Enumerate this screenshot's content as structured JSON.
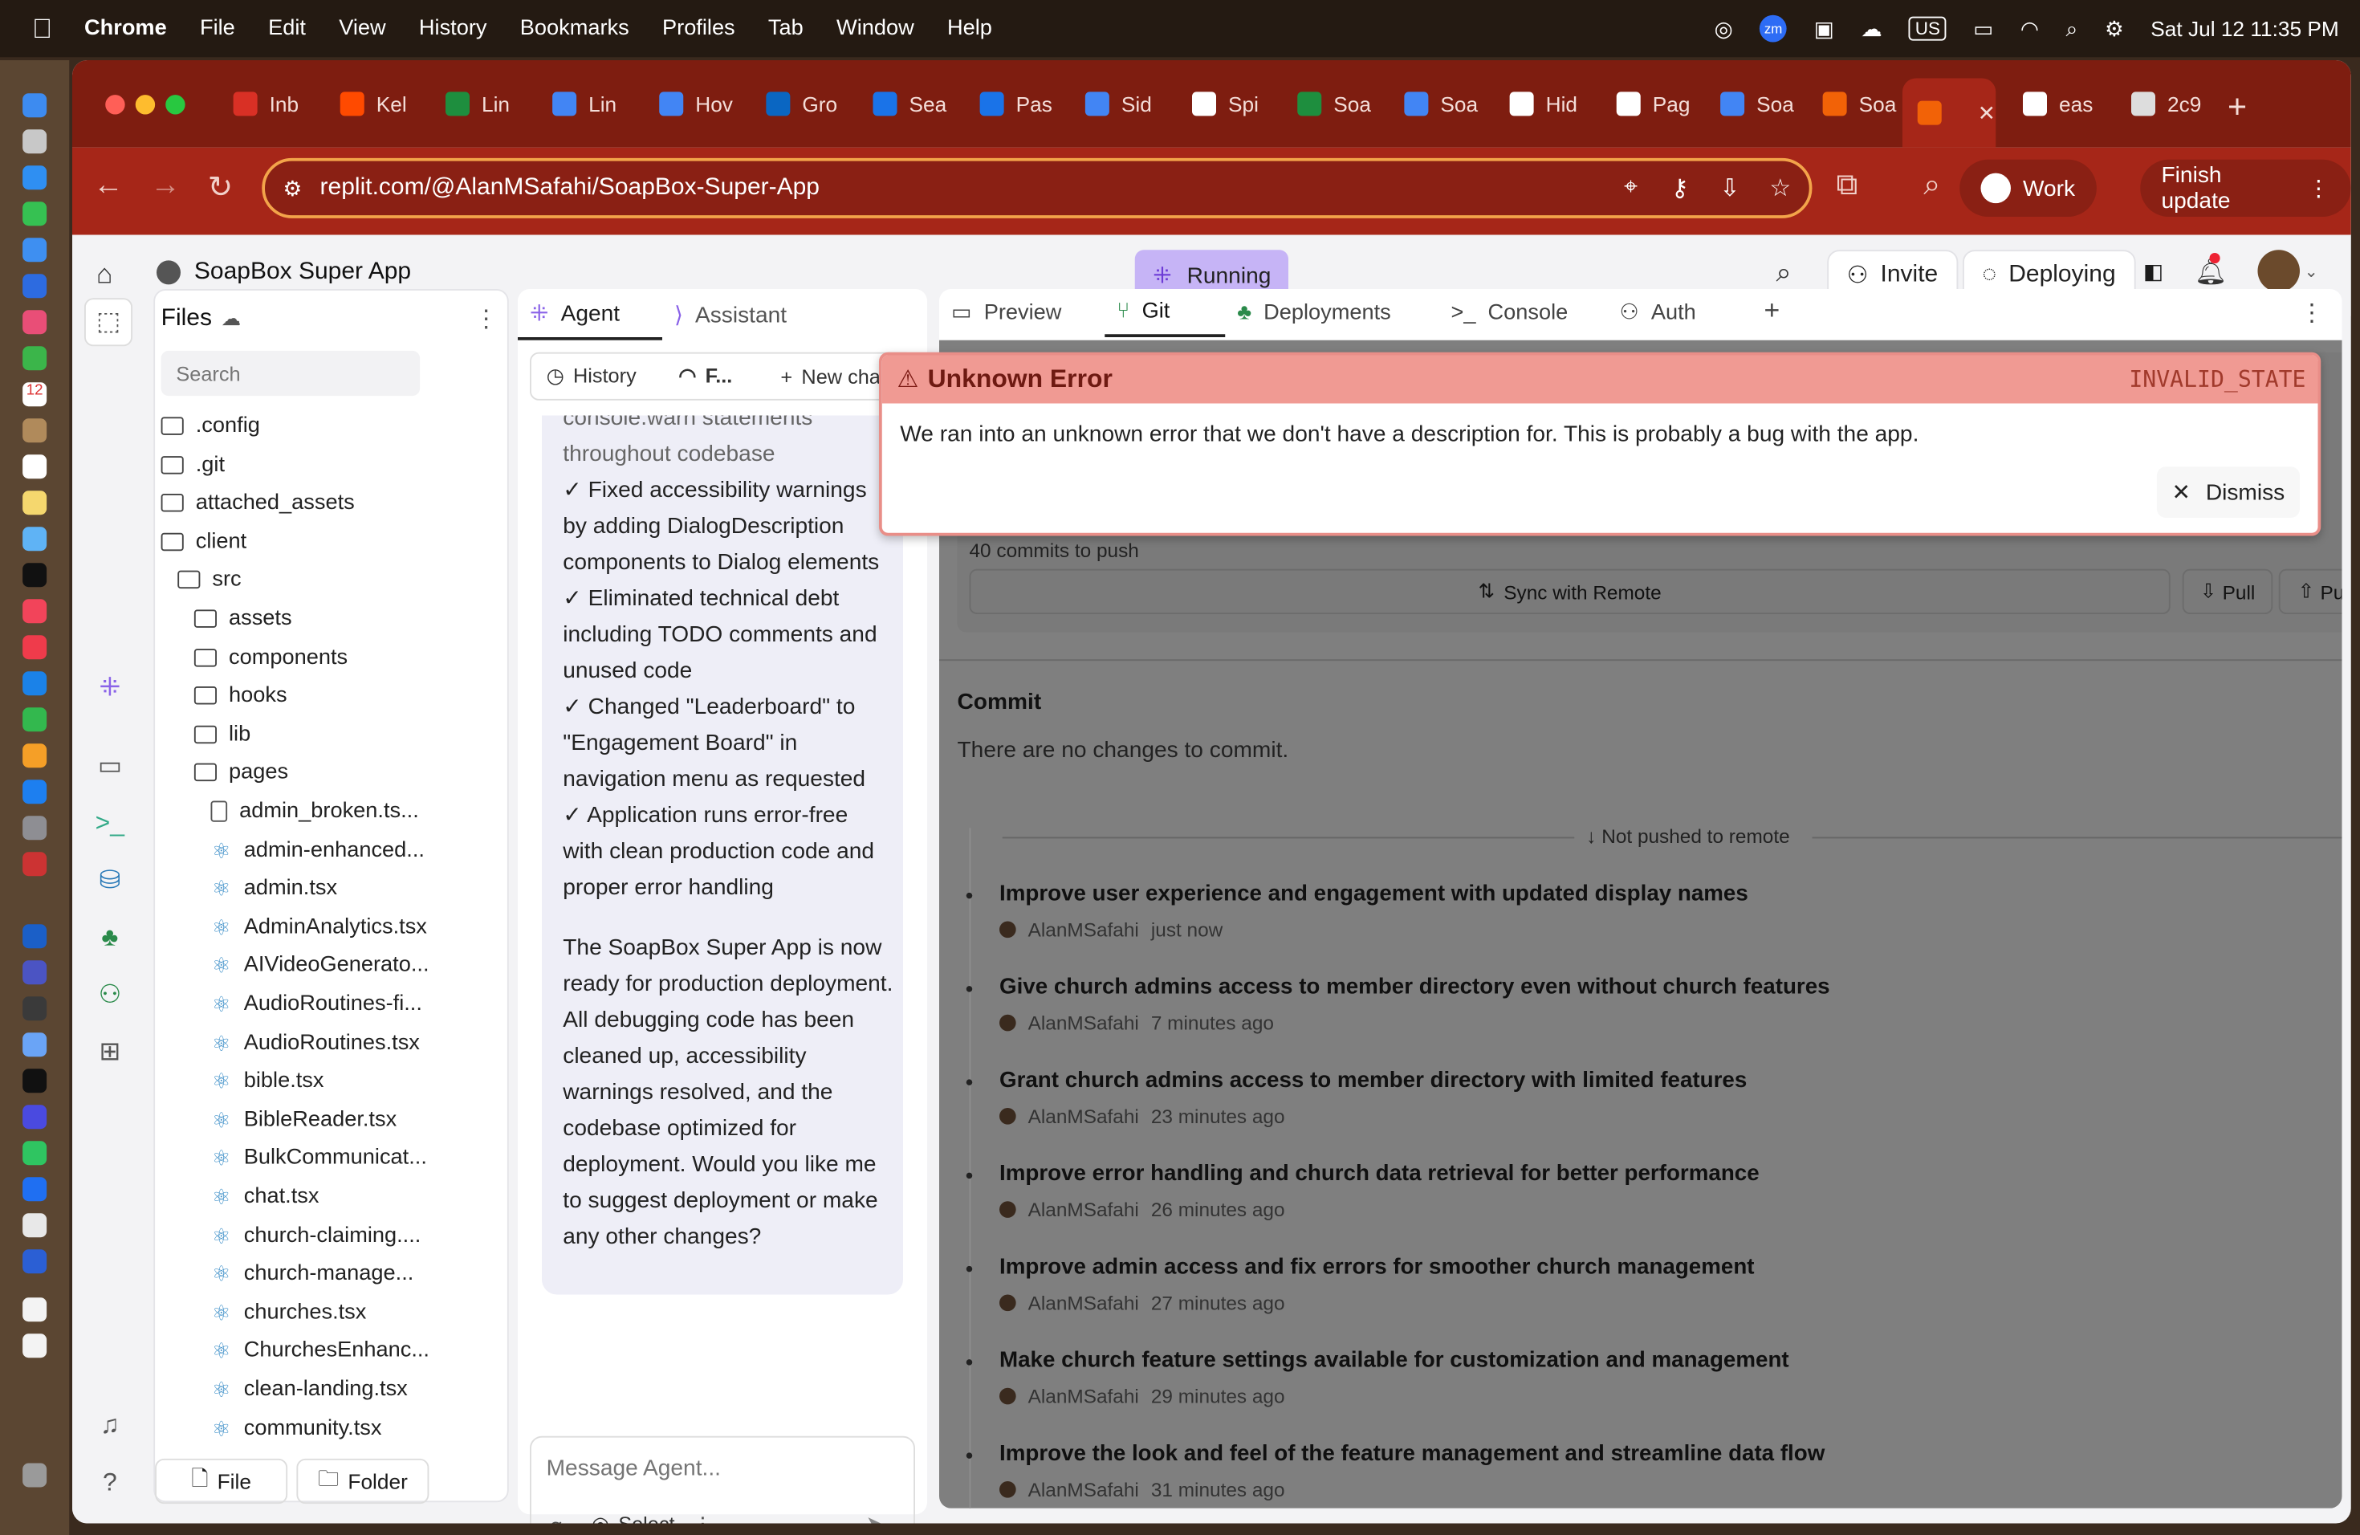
{
  "menubar": {
    "app": "Chrome",
    "items": [
      "File",
      "Edit",
      "View",
      "History",
      "Bookmarks",
      "Profiles",
      "Tab",
      "Window",
      "Help"
    ],
    "input_source": "US",
    "datetime": "Sat Jul 12  11:35 PM"
  },
  "tabs": [
    {
      "title": "Inb",
      "icon": "gmail-icon",
      "color": "#d93025"
    },
    {
      "title": "Kel",
      "icon": "zapier-icon",
      "color": "#ff4a00"
    },
    {
      "title": "Lin",
      "icon": "sheets-icon",
      "color": "#1e8e3e"
    },
    {
      "title": "Lin",
      "icon": "docs-icon",
      "color": "#4285f4"
    },
    {
      "title": "Hov",
      "icon": "docs-icon",
      "color": "#4285f4"
    },
    {
      "title": "Gro",
      "icon": "linkedin-icon",
      "color": "#0a66c2"
    },
    {
      "title": "Sea",
      "icon": "safari-icon",
      "color": "#1a73e8"
    },
    {
      "title": "Pas",
      "icon": "safari-icon",
      "color": "#1a73e8"
    },
    {
      "title": "Sid",
      "icon": "docs-icon",
      "color": "#4285f4"
    },
    {
      "title": "Spi",
      "icon": "spin-icon",
      "color": "#ffffff"
    },
    {
      "title": "Soa",
      "icon": "sheets-icon",
      "color": "#1e8e3e"
    },
    {
      "title": "Soa",
      "icon": "docs-icon",
      "color": "#4285f4"
    },
    {
      "title": "Hid",
      "icon": "openai-icon",
      "color": "#ffffff"
    },
    {
      "title": "Pag",
      "icon": "github-icon",
      "color": "#ffffff"
    },
    {
      "title": "Soa",
      "icon": "docs-icon",
      "color": "#4285f4"
    },
    {
      "title": "Soa",
      "icon": "replit-icon",
      "color": "#f26207"
    },
    {
      "title": "",
      "icon": "replit-icon",
      "color": "#f26207",
      "active": true
    },
    {
      "title": "eas",
      "icon": "google-icon",
      "color": "#ffffff"
    },
    {
      "title": "2c9",
      "icon": "globe-icon",
      "color": "#dddddd"
    }
  ],
  "browser": {
    "url": "replit.com/@AlanMSafahi/SoapBox-Super-App",
    "profile": "Work",
    "update": "Finish update"
  },
  "app": {
    "title": "SoapBox Super App",
    "status": "Running",
    "invite": "Invite",
    "deploying": "Deploying"
  },
  "files": {
    "title": "Files",
    "search_placeholder": "Search",
    "file_button": "File",
    "folder_button": "Folder",
    "tree": [
      {
        "name": ".config",
        "type": "folder",
        "depth": 0
      },
      {
        "name": ".git",
        "type": "folder",
        "depth": 0
      },
      {
        "name": "attached_assets",
        "type": "folder",
        "depth": 0
      },
      {
        "name": "client",
        "type": "folder",
        "depth": 0
      },
      {
        "name": "src",
        "type": "folder",
        "depth": 1
      },
      {
        "name": "assets",
        "type": "folder",
        "depth": 2
      },
      {
        "name": "components",
        "type": "folder",
        "depth": 2
      },
      {
        "name": "hooks",
        "type": "folder",
        "depth": 2
      },
      {
        "name": "lib",
        "type": "folder",
        "depth": 2
      },
      {
        "name": "pages",
        "type": "folder",
        "depth": 2
      },
      {
        "name": "admin_broken.ts...",
        "type": "file",
        "depth": 3
      },
      {
        "name": "admin-enhanced...",
        "type": "react",
        "depth": 3
      },
      {
        "name": "admin.tsx",
        "type": "react",
        "depth": 3
      },
      {
        "name": "AdminAnalytics.tsx",
        "type": "react",
        "depth": 3
      },
      {
        "name": "AIVideoGenerato...",
        "type": "react",
        "depth": 3
      },
      {
        "name": "AudioRoutines-fi...",
        "type": "react",
        "depth": 3
      },
      {
        "name": "AudioRoutines.tsx",
        "type": "react",
        "depth": 3
      },
      {
        "name": "bible.tsx",
        "type": "react",
        "depth": 3
      },
      {
        "name": "BibleReader.tsx",
        "type": "react",
        "depth": 3
      },
      {
        "name": "BulkCommunicat...",
        "type": "react",
        "depth": 3
      },
      {
        "name": "chat.tsx",
        "type": "react",
        "depth": 3
      },
      {
        "name": "church-claiming....",
        "type": "react",
        "depth": 3
      },
      {
        "name": "church-manage...",
        "type": "react",
        "depth": 3
      },
      {
        "name": "churches.tsx",
        "type": "react",
        "depth": 3
      },
      {
        "name": "ChurchesEnhanc...",
        "type": "react",
        "depth": 3
      },
      {
        "name": "clean-landing.tsx",
        "type": "react",
        "depth": 3
      },
      {
        "name": "community.tsx",
        "type": "react",
        "depth": 3
      }
    ]
  },
  "agent": {
    "tab_agent": "Agent",
    "tab_assistant": "Assistant",
    "history": "History",
    "checkpoint": "F...",
    "new_chat": "New chat",
    "message_top": "console.warn statements throughout codebase",
    "message_lines": [
      "✓ Fixed accessibility warnings by adding DialogDescription components to Dialog elements",
      "✓ Eliminated technical debt including TODO comments and unused code",
      "✓ Changed \"Leaderboard\" to \"Engagement Board\" in navigation menu as requested",
      "✓ Application runs error-free with clean production code and proper error handling"
    ],
    "message_summary": "The SoapBox Super App is now ready for production deployment. All debugging code has been cleaned up, accessibility warnings resolved, and the codebase optimized for deployment. Would you like me to suggest deployment or make any other changes?",
    "input_placeholder": "Message Agent...",
    "select": "Select"
  },
  "right": {
    "tabs": [
      "Preview",
      "Git",
      "Deployments",
      "Console",
      "Auth"
    ],
    "commits_to_push": "40 commits to push",
    "sync": "Sync with Remote",
    "pull": "Pull",
    "push": "Push",
    "commit_heading": "Commit",
    "no_changes": "There are no changes to commit.",
    "not_pushed": "Not pushed to remote",
    "commits": [
      {
        "title": "Improve user experience and engagement with updated display names",
        "author": "AlanMSafahi",
        "time": "just now"
      },
      {
        "title": "Give church admins access to member directory even without church features",
        "author": "AlanMSafahi",
        "time": "7 minutes ago"
      },
      {
        "title": "Grant church admins access to member directory with limited features",
        "author": "AlanMSafahi",
        "time": "23 minutes ago"
      },
      {
        "title": "Improve error handling and church data retrieval for better performance",
        "author": "AlanMSafahi",
        "time": "26 minutes ago"
      },
      {
        "title": "Improve admin access and fix errors for smoother church management",
        "author": "AlanMSafahi",
        "time": "27 minutes ago"
      },
      {
        "title": "Make church feature settings available for customization and management",
        "author": "AlanMSafahi",
        "time": "29 minutes ago"
      },
      {
        "title": "Improve the look and feel of the feature management and streamline data flow",
        "author": "AlanMSafahi",
        "time": "31 minutes ago"
      }
    ]
  },
  "error": {
    "title": "Unknown Error",
    "code": "INVALID_STATE",
    "message": "We ran into an unknown error that we don't have a description for. This is probably a bug with the app.",
    "dismiss": "Dismiss"
  }
}
